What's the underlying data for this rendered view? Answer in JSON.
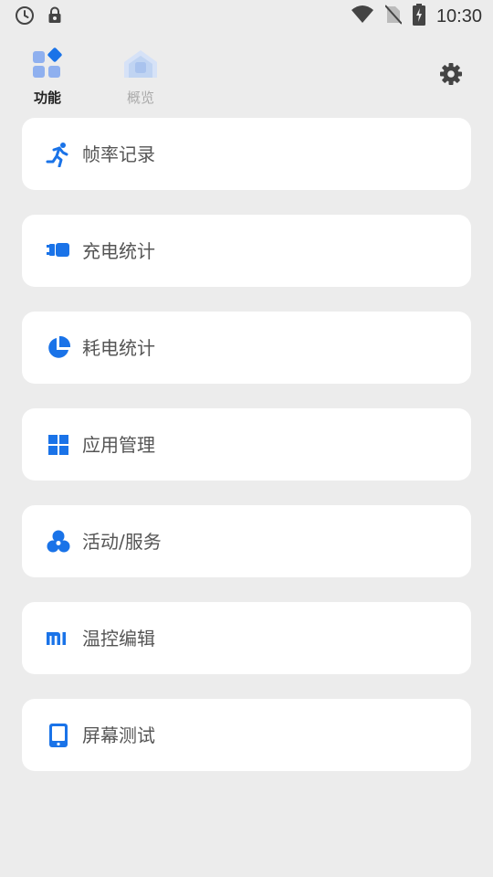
{
  "status_bar": {
    "time": "10:30",
    "left_icons": [
      "clock-icon",
      "lock-icon"
    ],
    "right_icons": [
      "wifi-icon",
      "no-sim-icon",
      "battery-charging-icon"
    ]
  },
  "tabs": [
    {
      "label": "功能",
      "icon": "feature-grid-icon",
      "active": true
    },
    {
      "label": "概览",
      "icon": "home-icon",
      "active": false
    }
  ],
  "settings": {
    "icon": "gear-icon"
  },
  "accent_color": "#1a73e8",
  "menu": [
    {
      "label": "帧率记录",
      "icon": "running-icon"
    },
    {
      "label": "充电统计",
      "icon": "charger-plug-icon"
    },
    {
      "label": "耗电统计",
      "icon": "pie-chart-icon"
    },
    {
      "label": "应用管理",
      "icon": "grid-icon"
    },
    {
      "label": "活动/服务",
      "icon": "cluster-icon"
    },
    {
      "label": "温控编辑",
      "icon": "mi-logo-icon"
    },
    {
      "label": "屏幕测试",
      "icon": "tablet-icon"
    }
  ]
}
